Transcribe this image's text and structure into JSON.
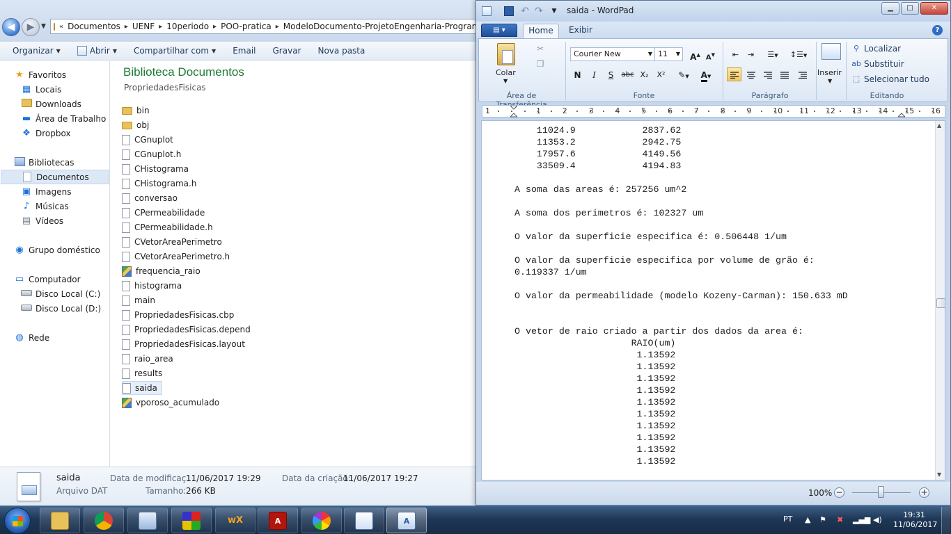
{
  "explorer": {
    "breadcrumb": [
      "Documentos",
      "UENF",
      "10periodo",
      "POO-pratica",
      "ModeloDocumento-ProjetoEngenharia-Programa"
    ],
    "toolbar": {
      "organize": "Organizar",
      "open": "Abrir",
      "share": "Compartilhar com",
      "email": "Email",
      "burn": "Gravar",
      "new_folder": "Nova pasta"
    },
    "nav": {
      "favorites": "Favoritos",
      "locals": "Locais",
      "downloads": "Downloads",
      "desktop": "Área de Trabalho",
      "dropbox": "Dropbox",
      "libraries": "Bibliotecas",
      "documents": "Documentos",
      "images": "Imagens",
      "music": "Músicas",
      "videos": "Vídeos",
      "homegroup": "Grupo doméstico",
      "computer": "Computador",
      "disk_c": "Disco Local (C:)",
      "disk_d": "Disco Local (D:)",
      "network": "Rede"
    },
    "library_title": "Biblioteca Documentos",
    "library_subtitle": "PropriedadesFisicas",
    "files": [
      {
        "name": "bin",
        "type": "folder"
      },
      {
        "name": "obj",
        "type": "folder"
      },
      {
        "name": "CGnuplot",
        "type": "file"
      },
      {
        "name": "CGnuplot.h",
        "type": "file"
      },
      {
        "name": "CHistograma",
        "type": "file"
      },
      {
        "name": "CHistograma.h",
        "type": "file"
      },
      {
        "name": "conversao",
        "type": "file"
      },
      {
        "name": "CPermeabilidade",
        "type": "file"
      },
      {
        "name": "CPermeabilidade.h",
        "type": "file"
      },
      {
        "name": "CVetorAreaPerimetro",
        "type": "file"
      },
      {
        "name": "CVetorAreaPerimetro.h",
        "type": "file"
      },
      {
        "name": "frequencia_raio",
        "type": "image"
      },
      {
        "name": "histograma",
        "type": "file"
      },
      {
        "name": "main",
        "type": "file"
      },
      {
        "name": "PropriedadesFisicas.cbp",
        "type": "file"
      },
      {
        "name": "PropriedadesFisicas.depend",
        "type": "file"
      },
      {
        "name": "PropriedadesFisicas.layout",
        "type": "file"
      },
      {
        "name": "raio_area",
        "type": "file"
      },
      {
        "name": "results",
        "type": "file"
      },
      {
        "name": "saida",
        "type": "file"
      },
      {
        "name": "vporoso_acumulado",
        "type": "image"
      }
    ],
    "selected_file": "saida",
    "details": {
      "name": "saida",
      "type": "Arquivo DAT",
      "modified_label": "Data de modificaç...",
      "modified_value": "11/06/2017 19:29",
      "created_label": "Data da criação:",
      "created_value": "11/06/2017 19:27",
      "size_label": "Tamanho:",
      "size_value": "266 KB"
    }
  },
  "wordpad": {
    "title": "saida - WordPad",
    "tabs": {
      "home": "Home",
      "view": "Exibir"
    },
    "clipboard": {
      "paste": "Colar",
      "group": "Área de Transferência"
    },
    "font": {
      "family": "Courier New",
      "size": "11",
      "group": "Fonte",
      "bold": "N",
      "italic": "I",
      "underline": "S",
      "strike": "abc",
      "subscript": "X₂",
      "superscript": "X²"
    },
    "paragraph": {
      "group": "Parágrafo"
    },
    "insert": {
      "label": "Inserir"
    },
    "editing": {
      "find": "Localizar",
      "replace": "Substituir",
      "select_all": "Selecionar tudo",
      "group": "Editando"
    },
    "ruler_numbers": [
      "1",
      "1",
      "2",
      "3",
      "4",
      "5",
      "6",
      "7",
      "8",
      "9",
      "10",
      "11",
      "12",
      "13",
      "14",
      "15",
      "16"
    ],
    "document_lines": [
      "    11024.9            2837.62",
      "    11353.2            2942.75",
      "    17957.6            4149.56",
      "    33509.4            4194.83",
      "",
      "A soma das areas é: 257256 um^2",
      "",
      "A soma dos perimetros é: 102327 um",
      "",
      "O valor da superficie especifica é: 0.506448 1/um",
      "",
      "O valor da superficie especifica por volume de grão é:",
      "0.119337 1/um",
      "",
      "O valor da permeabilidade (modelo Kozeny-Carman): 150.633 mD",
      "",
      "",
      "O vetor de raio criado a partir dos dados da area é:",
      "                     RAIO(um)",
      "                      1.13592",
      "                      1.13592",
      "                      1.13592",
      "                      1.13592",
      "                      1.13592",
      "                      1.13592",
      "                      1.13592",
      "                      1.13592",
      "                      1.13592",
      "                      1.13592"
    ],
    "zoom": "100%"
  },
  "taskbar": {
    "lang": "PT",
    "time": "19:31",
    "date": "11/06/2017"
  }
}
